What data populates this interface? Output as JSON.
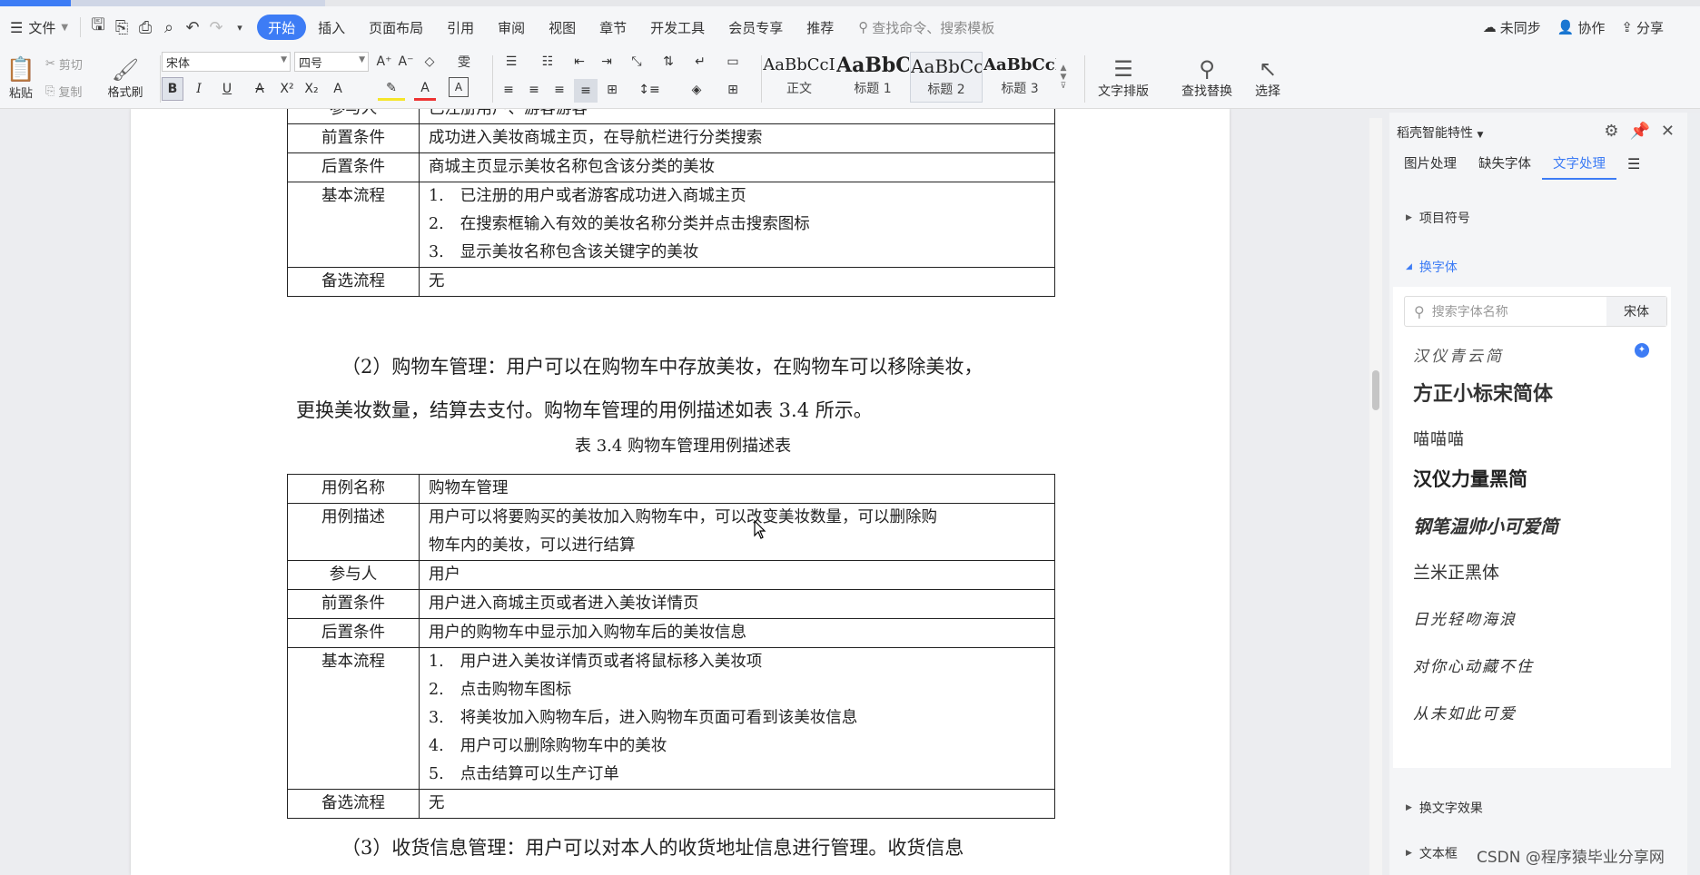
{
  "menubar": {
    "menu_label": "文件",
    "tabs": [
      "开始",
      "插入",
      "页面布局",
      "引用",
      "审阅",
      "视图",
      "章节",
      "开发工具",
      "会员专享",
      "推荐"
    ],
    "active_tab": "开始",
    "search_placeholder": "查找命令、搜索模板",
    "right": {
      "sync": "未同步",
      "collab": "协作",
      "share": "分享"
    }
  },
  "ribbon": {
    "paste": "粘贴",
    "cut": "剪切",
    "copy": "复制",
    "format_painter": "格式刷",
    "font_name": "宋体",
    "font_size": "四号",
    "styles": [
      {
        "sample": "AaBbCcI",
        "label": "正文"
      },
      {
        "sample": "AaBbC",
        "label": "标题 1"
      },
      {
        "sample": "AaBbCc",
        "label": "标题 2"
      },
      {
        "sample": "AaBbCcI",
        "label": "标题 3"
      }
    ],
    "text_layout": "文字排版",
    "find_replace": "查找替换",
    "select": "选择"
  },
  "document": {
    "table1": {
      "partial_row": "参与人",
      "partial_row_value": "已注册用户、游客游客",
      "rows": [
        {
          "h": "前置条件",
          "v": "成功进入美妆商城主页，在导航栏进行分类搜索"
        },
        {
          "h": "后置条件",
          "v": "商城主页显示美妆名称包含该分类的美妆"
        }
      ],
      "flow_h": "基本流程",
      "flow": [
        {
          "n": "1.",
          "t": "已注册的用户或者游客成功进入商城主页"
        },
        {
          "n": "2.",
          "t": "在搜索框输入有效的美妆名称分类并点击搜索图标"
        },
        {
          "n": "3.",
          "t": "显示美妆名称包含该关键字的美妆"
        }
      ],
      "alt_h": "备选流程",
      "alt_v": "无"
    },
    "para2_line1": "（2）购物车管理：用户可以在购物车中存放美妆，在购物车可以移除美妆，",
    "para2_line2": "更换美妆数量，结算去支付。购物车管理的用例描述如表 3.4 所示。",
    "caption": "表 3.4  购物车管理用例描述表",
    "table2": {
      "name_h": "用例名称",
      "name_v": "购物车管理",
      "desc_h": "用例描述",
      "desc_v1": "用户可以将要购买的美妆加入购物车中，可以改变美妆数量，可以删除购",
      "desc_v2": "物车内的美妆，可以进行结算",
      "actor_h": "参与人",
      "actor_v": "用户",
      "pre_h": "前置条件",
      "pre_v": "用户进入商城主页或者进入美妆详情页",
      "post_h": "后置条件",
      "post_v": "用户的购物车中显示加入购物车后的美妆信息",
      "flow_h": "基本流程",
      "flow": [
        {
          "n": "1.",
          "t": "用户进入美妆详情页或者将鼠标移入美妆项"
        },
        {
          "n": "2.",
          "t": "点击购物车图标"
        },
        {
          "n": "3.",
          "t": "将美妆加入购物车后，进入购物车页面可看到该美妆信息"
        },
        {
          "n": "4.",
          "t": "用户可以删除购物车中的美妆"
        },
        {
          "n": "5.",
          "t": "点击结算可以生产订单"
        }
      ],
      "alt_h": "备选流程",
      "alt_v": "无"
    },
    "para3": "（3）收货信息管理：用户可以对本人的收货地址信息进行管理。收货信息"
  },
  "panel": {
    "title": "稻壳智能特性",
    "tabs": [
      "图片处理",
      "缺失字体",
      "文字处理"
    ],
    "active_tab": "文字处理",
    "sec_bullets": "项目符号",
    "sec_font": "换字体",
    "font_search_placeholder": "搜索字体名称",
    "current_font": "宋体",
    "fonts": [
      "汉仪青云简",
      "方正小标宋简体",
      "喵喵喵",
      "汉仪力量黑简",
      "钢笔温帅小可爱简",
      "兰米正黑体",
      "日光轻吻海浪",
      "对你心动藏不住",
      "从未如此可爱"
    ],
    "sec_effect": "换文字效果",
    "sec_textbox": "文本框"
  },
  "watermark": "CSDN @程序猿毕业分享网"
}
